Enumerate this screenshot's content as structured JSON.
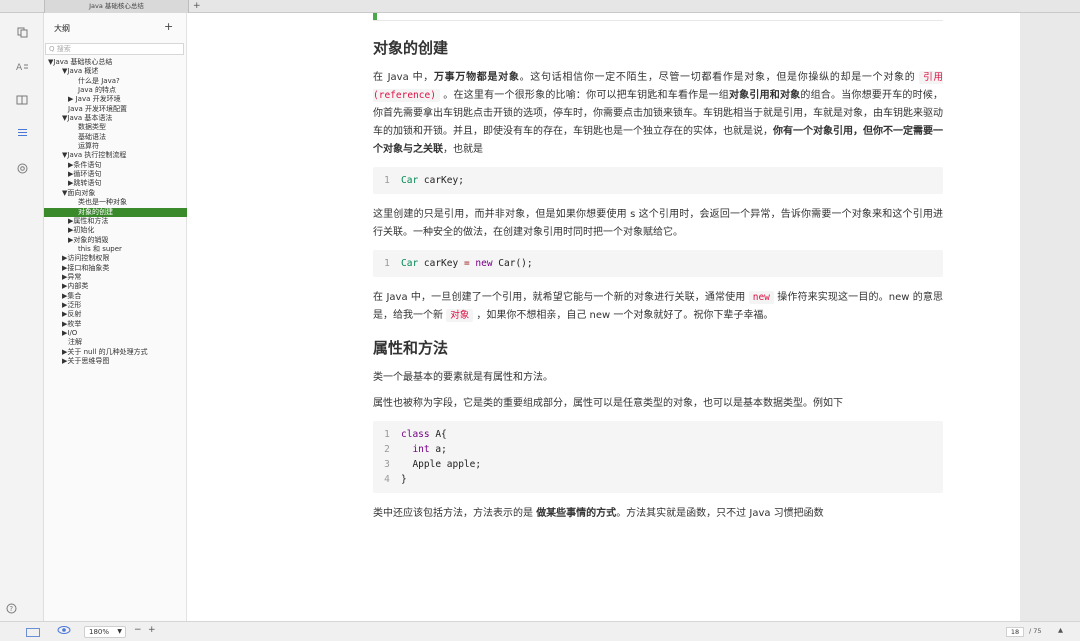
{
  "tab": {
    "title": "Java 基础核心总结",
    "add": "+"
  },
  "rail": {
    "icons": [
      "copy-icon",
      "font-icon",
      "book-icon",
      "list-icon",
      "target-icon",
      "help-icon"
    ],
    "help": "?"
  },
  "sidebar": {
    "header": "大纲",
    "add": "+",
    "search_placeholder": "Q 搜索",
    "items": [
      "▼Java 基础核心总结",
      "▼Java 概述",
      "什么是 Java?",
      "Java 的特点",
      "▶ Java 开发环境",
      "Java 开发环境配置",
      "▼Java 基本语法",
      "数据类型",
      "基础语法",
      "运算符",
      "▼Java 执行控制流程",
      "▶条件语句",
      "▶循环语句",
      "▶跳转语句",
      "▼面向对象",
      "类也是一种对象",
      "对象的创建",
      "▶属性和方法",
      "▶初始化",
      "▶对象的销毁",
      "this 和 super",
      "▶访问控制权限",
      "▶接口和抽象类",
      "▶异常",
      "▶内部类",
      "▶集合",
      "▶泛形",
      "▶反射",
      "▶枚举",
      "▶I/O",
      "注解",
      "▶关于 null 的几种处理方式",
      "▶关于思维导图"
    ],
    "selected_index": 16
  },
  "content": {
    "h1": "对象的创建",
    "p1_a": "在 Java 中，",
    "p1_b": "万事万物都是对象",
    "p1_c": "。这句话相信你一定不陌生，尽管一切都看作是对象，但是你操纵的却是一个对象的 ",
    "p1_code": "引用(reference)",
    "p1_d": " 。在这里有一个很形象的比喻：你可以把车钥匙和车看作是一组",
    "p1_e": "对象引用和对象",
    "p1_f": "的组合。当你想要开车的时候，你首先需要拿出车钥匙点击开锁的选项，停车时，你需要点击加锁来锁车。车钥匙相当于就是引用，车就是对象，由车钥匙来驱动车的加锁和开锁。并且，即使没有车的存在，车钥匙也是一个独立存在的实体，也就是说，",
    "p1_g": "你有一个对象引用，但你不一定需要一个对象与之关联",
    "p1_h": "，也就是",
    "code1": {
      "n1": "1",
      "t1": "Car",
      "v1": " carKey;"
    },
    "p2": "这里创建的只是引用，而并非对象，但是如果你想要使用 s 这个引用时，会返回一个异常，告诉你需要一个对象来和这个引用进行关联。一种安全的做法，在创建对象引用时同时把一个对象赋给它。",
    "code2": {
      "n1": "1",
      "t1": "Car",
      "v1": " carKey ",
      "op": "=",
      "kw": " new",
      "v2": " Car();"
    },
    "p3_a": "在 Java 中，一旦创建了一个引用，就希望它能与一个新的对象进行关联，通常使用 ",
    "p3_code1": "new",
    "p3_b": " 操作符来实现这一目的。new 的意思是，给我一个新 ",
    "p3_code2": "对象",
    "p3_c": " ，如果你不想相亲，自己 new 一个对象就好了。祝你下辈子幸福。",
    "h2": "属性和方法",
    "p4": "类一个最基本的要素就是有属性和方法。",
    "p5": "属性也被称为字段，它是类的重要组成部分，属性可以是任意类型的对象，也可以是基本数据类型。例如下",
    "code3": {
      "n1": "1",
      "n2": "2",
      "n3": "3",
      "n4": "4",
      "l1_kw": "class",
      "l1_rest": " A{",
      "l2_kw": "int",
      "l2_rest": " a;",
      "l3": "Apple apple;",
      "l4": "}"
    },
    "p6_a": "类中还应该包括方法，方法表示的是 ",
    "p6_b": "做某些事情的方式",
    "p6_c": "。方法其实就是函数，只不过 Java 习惯把函数"
  },
  "status": {
    "zoom": "180%",
    "minus": "−",
    "plus": "+",
    "page_current": "18",
    "page_total": "/ 75",
    "up": "▲"
  }
}
